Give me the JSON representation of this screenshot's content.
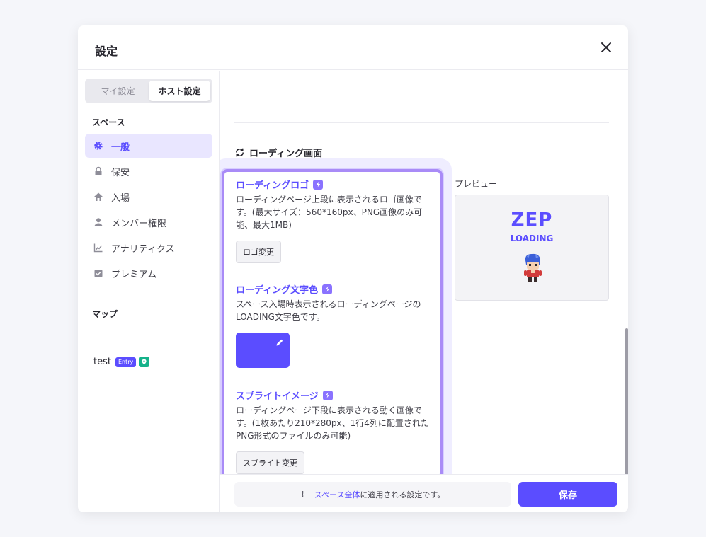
{
  "dialog": {
    "title": "設定"
  },
  "tabs": {
    "my_settings": "マイ設定",
    "host_settings": "ホスト設定"
  },
  "sidebar": {
    "space_label": "スペース",
    "items": [
      {
        "label": "一般",
        "icon": "gear-icon"
      },
      {
        "label": "保安",
        "icon": "lock-icon"
      },
      {
        "label": "入場",
        "icon": "home-icon"
      },
      {
        "label": "メンバー権限",
        "icon": "person-icon"
      },
      {
        "label": "アナリティクス",
        "icon": "chart-icon"
      },
      {
        "label": "プレミアム",
        "icon": "premium-box-icon"
      }
    ],
    "map_label": "マップ",
    "map_name": "test",
    "map_badge": "Entry"
  },
  "main": {
    "cut_text": "・・・・ ・・・・・・・ ・・・・",
    "section_title": "ローディング画面",
    "features": [
      {
        "title": "ローディングロゴ",
        "desc": "ローディングページ上段に表示されるロゴ画像です。(最大サイズ：560*160px、PNG画像のみ可能、最大1MB)",
        "button": "ロゴ変更"
      },
      {
        "title": "ローディング文字色",
        "desc": "スペース入場時表示されるローディングページのLOADING文字色です。",
        "color": "#5b4dff"
      },
      {
        "title": "スプライトイメージ",
        "desc": "ローディングページ下段に表示される動く画像です。(1枚あたり210*280px、1行4列に配置されたPNG形式のファイルのみ可能)",
        "button": "スプライト変更"
      }
    ],
    "preview": {
      "label": "プレビュー",
      "logo_text": "ZEP",
      "loading_text": "LOADING"
    }
  },
  "footer": {
    "notice_icon": "!",
    "notice_highlight": "スペース全体",
    "notice_rest": "に適用される設定です。",
    "save_label": "保存"
  },
  "colors": {
    "accent": "#5b4dff",
    "highlight_border": "#a98bf7",
    "active_nav_bg": "#e9e6ff"
  }
}
